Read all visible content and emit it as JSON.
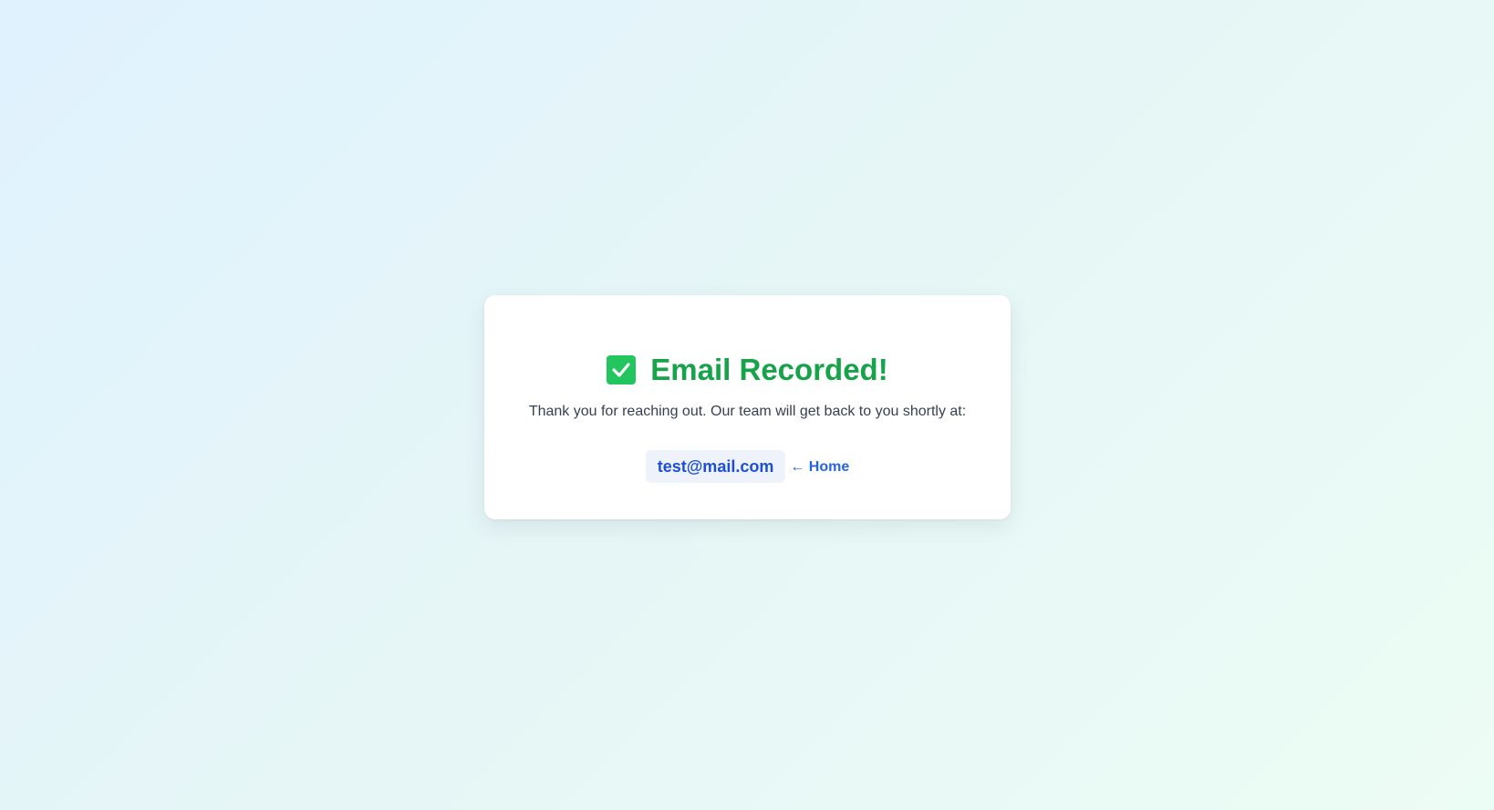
{
  "confirmation": {
    "title": "Email Recorded!",
    "message": "Thank you for reaching out. Our team will get back to you shortly at:",
    "email": "test@mail.com",
    "home_link": "← Home",
    "icon": "check-square-icon"
  },
  "colors": {
    "title": "#16a34a",
    "icon_bg": "#22c55e",
    "email_text": "#1d4ed8",
    "email_bg": "#eef2fb",
    "link": "#2563eb",
    "card_bg": "#ffffff"
  }
}
